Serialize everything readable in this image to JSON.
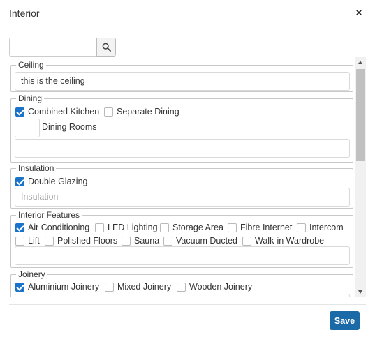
{
  "dialog": {
    "title": "Interior",
    "close_icon": "×"
  },
  "search": {
    "placeholder": "",
    "value": "",
    "button_icon": "search-icon"
  },
  "sections": {
    "ceiling": {
      "legend": "Ceiling",
      "value": "this is the ceiling"
    },
    "dining": {
      "legend": "Dining",
      "options": [
        {
          "label": "Combined Kitchen",
          "checked": true
        },
        {
          "label": "Separate Dining",
          "checked": false
        }
      ],
      "rooms_label": "Dining Rooms",
      "rooms_value": "",
      "notes_value": ""
    },
    "insulation": {
      "legend": "Insulation",
      "options": [
        {
          "label": "Double Glazing",
          "checked": true
        }
      ],
      "notes_placeholder": "Insulation"
    },
    "interior_features": {
      "legend": "Interior Features",
      "options": [
        {
          "label": "Air Conditioning",
          "checked": true
        },
        {
          "label": "LED Lighting",
          "checked": false
        },
        {
          "label": "Storage Area",
          "checked": false
        },
        {
          "label": "Fibre Internet",
          "checked": false
        },
        {
          "label": "Intercom",
          "checked": false
        },
        {
          "label": "Lift",
          "checked": false
        },
        {
          "label": "Polished Floors",
          "checked": false
        },
        {
          "label": "Sauna",
          "checked": false
        },
        {
          "label": "Vacuum Ducted",
          "checked": false
        },
        {
          "label": "Walk-in Wardrobe",
          "checked": false
        }
      ],
      "notes_value": ""
    },
    "joinery": {
      "legend": "Joinery",
      "options": [
        {
          "label": "Aluminium Joinery",
          "checked": true
        },
        {
          "label": "Mixed Joinery",
          "checked": false
        },
        {
          "label": "Wooden Joinery",
          "checked": false
        }
      ]
    }
  },
  "footer": {
    "save_label": "Save"
  },
  "colors": {
    "primary": "#1b6aa8",
    "checkbox_checked": "#1a73c9",
    "border": "#c8c8c8"
  }
}
